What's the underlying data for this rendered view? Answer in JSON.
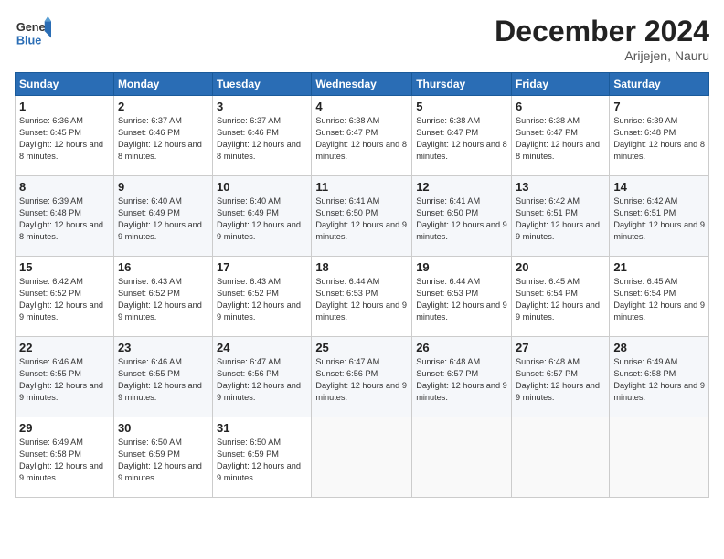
{
  "header": {
    "logo_general": "General",
    "logo_blue": "Blue",
    "month_title": "December 2024",
    "location": "Arijejen, Nauru"
  },
  "weekdays": [
    "Sunday",
    "Monday",
    "Tuesday",
    "Wednesday",
    "Thursday",
    "Friday",
    "Saturday"
  ],
  "weeks": [
    [
      {
        "day": "1",
        "sunrise": "6:36 AM",
        "sunset": "6:45 PM",
        "daylight": "12 hours and 8 minutes."
      },
      {
        "day": "2",
        "sunrise": "6:37 AM",
        "sunset": "6:46 PM",
        "daylight": "12 hours and 8 minutes."
      },
      {
        "day": "3",
        "sunrise": "6:37 AM",
        "sunset": "6:46 PM",
        "daylight": "12 hours and 8 minutes."
      },
      {
        "day": "4",
        "sunrise": "6:38 AM",
        "sunset": "6:47 PM",
        "daylight": "12 hours and 8 minutes."
      },
      {
        "day": "5",
        "sunrise": "6:38 AM",
        "sunset": "6:47 PM",
        "daylight": "12 hours and 8 minutes."
      },
      {
        "day": "6",
        "sunrise": "6:38 AM",
        "sunset": "6:47 PM",
        "daylight": "12 hours and 8 minutes."
      },
      {
        "day": "7",
        "sunrise": "6:39 AM",
        "sunset": "6:48 PM",
        "daylight": "12 hours and 8 minutes."
      }
    ],
    [
      {
        "day": "8",
        "sunrise": "6:39 AM",
        "sunset": "6:48 PM",
        "daylight": "12 hours and 8 minutes."
      },
      {
        "day": "9",
        "sunrise": "6:40 AM",
        "sunset": "6:49 PM",
        "daylight": "12 hours and 9 minutes."
      },
      {
        "day": "10",
        "sunrise": "6:40 AM",
        "sunset": "6:49 PM",
        "daylight": "12 hours and 9 minutes."
      },
      {
        "day": "11",
        "sunrise": "6:41 AM",
        "sunset": "6:50 PM",
        "daylight": "12 hours and 9 minutes."
      },
      {
        "day": "12",
        "sunrise": "6:41 AM",
        "sunset": "6:50 PM",
        "daylight": "12 hours and 9 minutes."
      },
      {
        "day": "13",
        "sunrise": "6:42 AM",
        "sunset": "6:51 PM",
        "daylight": "12 hours and 9 minutes."
      },
      {
        "day": "14",
        "sunrise": "6:42 AM",
        "sunset": "6:51 PM",
        "daylight": "12 hours and 9 minutes."
      }
    ],
    [
      {
        "day": "15",
        "sunrise": "6:42 AM",
        "sunset": "6:52 PM",
        "daylight": "12 hours and 9 minutes."
      },
      {
        "day": "16",
        "sunrise": "6:43 AM",
        "sunset": "6:52 PM",
        "daylight": "12 hours and 9 minutes."
      },
      {
        "day": "17",
        "sunrise": "6:43 AM",
        "sunset": "6:52 PM",
        "daylight": "12 hours and 9 minutes."
      },
      {
        "day": "18",
        "sunrise": "6:44 AM",
        "sunset": "6:53 PM",
        "daylight": "12 hours and 9 minutes."
      },
      {
        "day": "19",
        "sunrise": "6:44 AM",
        "sunset": "6:53 PM",
        "daylight": "12 hours and 9 minutes."
      },
      {
        "day": "20",
        "sunrise": "6:45 AM",
        "sunset": "6:54 PM",
        "daylight": "12 hours and 9 minutes."
      },
      {
        "day": "21",
        "sunrise": "6:45 AM",
        "sunset": "6:54 PM",
        "daylight": "12 hours and 9 minutes."
      }
    ],
    [
      {
        "day": "22",
        "sunrise": "6:46 AM",
        "sunset": "6:55 PM",
        "daylight": "12 hours and 9 minutes."
      },
      {
        "day": "23",
        "sunrise": "6:46 AM",
        "sunset": "6:55 PM",
        "daylight": "12 hours and 9 minutes."
      },
      {
        "day": "24",
        "sunrise": "6:47 AM",
        "sunset": "6:56 PM",
        "daylight": "12 hours and 9 minutes."
      },
      {
        "day": "25",
        "sunrise": "6:47 AM",
        "sunset": "6:56 PM",
        "daylight": "12 hours and 9 minutes."
      },
      {
        "day": "26",
        "sunrise": "6:48 AM",
        "sunset": "6:57 PM",
        "daylight": "12 hours and 9 minutes."
      },
      {
        "day": "27",
        "sunrise": "6:48 AM",
        "sunset": "6:57 PM",
        "daylight": "12 hours and 9 minutes."
      },
      {
        "day": "28",
        "sunrise": "6:49 AM",
        "sunset": "6:58 PM",
        "daylight": "12 hours and 9 minutes."
      }
    ],
    [
      {
        "day": "29",
        "sunrise": "6:49 AM",
        "sunset": "6:58 PM",
        "daylight": "12 hours and 9 minutes."
      },
      {
        "day": "30",
        "sunrise": "6:50 AM",
        "sunset": "6:59 PM",
        "daylight": "12 hours and 9 minutes."
      },
      {
        "day": "31",
        "sunrise": "6:50 AM",
        "sunset": "6:59 PM",
        "daylight": "12 hours and 9 minutes."
      },
      null,
      null,
      null,
      null
    ]
  ]
}
